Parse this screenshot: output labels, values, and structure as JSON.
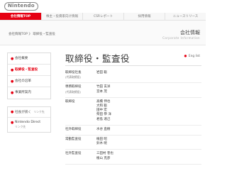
{
  "header": {
    "logo": "Nintendo",
    "nav": [
      {
        "label": "会社情報TOP",
        "active": true
      },
      {
        "label": "株主・投資家向け情報",
        "active": false
      },
      {
        "label": "CSRレポート",
        "active": false
      },
      {
        "label": "採用情報",
        "active": false
      },
      {
        "label": "ニュースリリース",
        "active": false
      }
    ]
  },
  "breadcrumb": {
    "home": "会社情報TOP",
    "separator": "》",
    "current": "取締役・監査役"
  },
  "section": {
    "title": "会社情報",
    "subtitle": "Corporate Information"
  },
  "sidebar": {
    "items": [
      {
        "label": "会社概要",
        "active": false
      },
      {
        "label": "取締役・監査役",
        "active": true
      },
      {
        "label": "会社の沿革",
        "active": false
      },
      {
        "label": "事業所案内",
        "active": false
      }
    ],
    "links": [
      {
        "label": "社長が訊く",
        "sub": "リンク先"
      },
      {
        "label": "Nintendo Direct",
        "sub": "リンク先"
      }
    ]
  },
  "main": {
    "heading": "取締役・監査役",
    "english_link": "Eng list",
    "roles": [
      {
        "position": "取締役社長",
        "note": "(代表取締役)",
        "names": [
          "岩田 聡"
        ]
      },
      {
        "position": "専務取締役",
        "note": "(代表取締役)",
        "names": [
          "竹田 玄洋",
          "宮本 茂"
        ]
      },
      {
        "position": "取締役",
        "note": "",
        "names": [
          "高橋 伸也",
          "大和 聡",
          "田中 宏",
          "柴田 恭 洋",
          "君島 達己"
        ]
      },
      {
        "position": "社外取締役",
        "note": "",
        "names": [
          "水谷 直樹"
        ]
      },
      {
        "position": "常勤監査役",
        "note": "",
        "names": [
          "植田 昭",
          "鈴木 暁"
        ]
      },
      {
        "position": "社外監査役",
        "note": "",
        "names": [
          "三田村 巻也",
          "植山 克彦"
        ]
      }
    ]
  }
}
